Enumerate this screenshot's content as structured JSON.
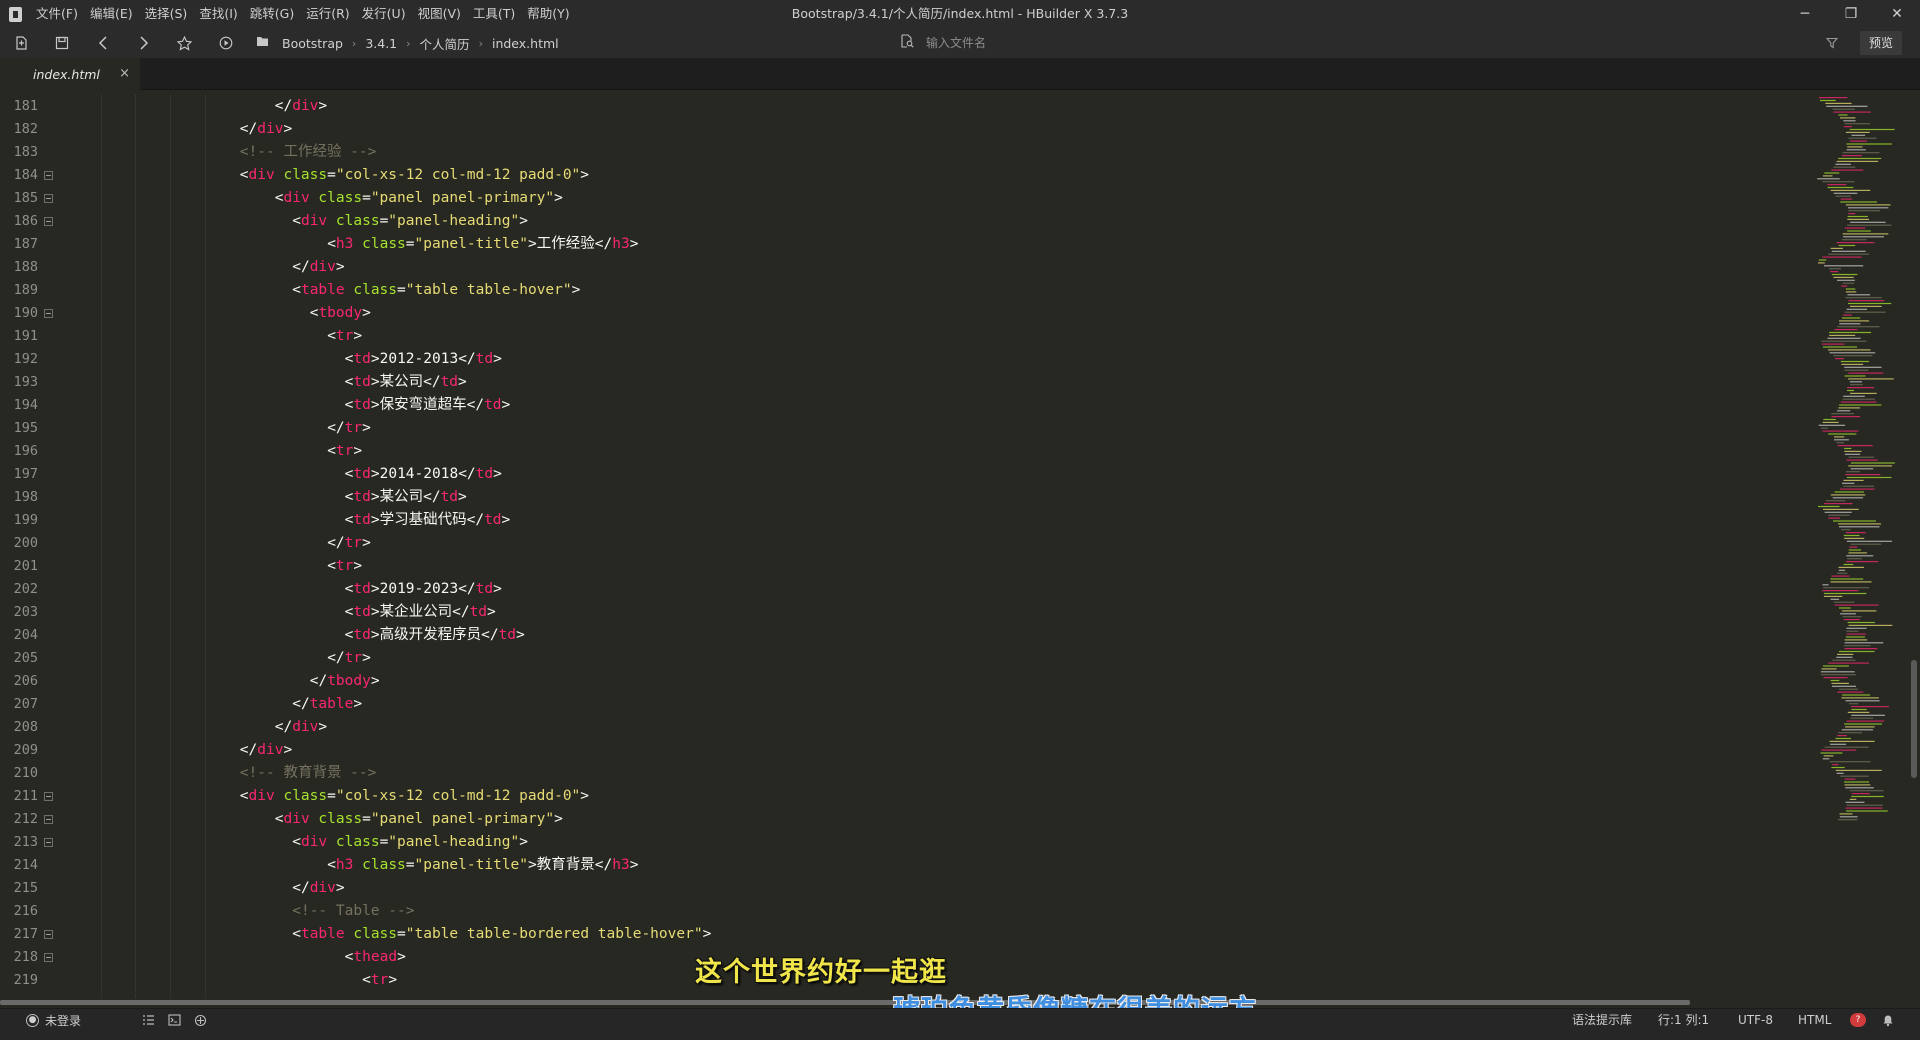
{
  "window": {
    "title": "Bootstrap/3.4.1/个人简历/index.html - HBuilder X 3.7.3",
    "controls": {
      "minimize": "─",
      "restore": "❐",
      "close": "✕"
    }
  },
  "menu": [
    "文件(F)",
    "编辑(E)",
    "选择(S)",
    "查找(I)",
    "跳转(G)",
    "运行(R)",
    "发行(U)",
    "视图(V)",
    "工具(T)",
    "帮助(Y)"
  ],
  "toolbar": {
    "breadcrumbs": [
      "Bootstrap",
      "3.4.1",
      "个人简历",
      "index.html"
    ],
    "search_placeholder": "输入文件名",
    "preview_label": "预览"
  },
  "tabs": [
    {
      "label": "index.html",
      "close": "×"
    }
  ],
  "editor": {
    "lines": [
      {
        "num": "181",
        "fold": false,
        "indent": 24,
        "tokens": [
          [
            "p",
            "</"
          ],
          [
            "t",
            "div"
          ],
          [
            "p",
            ">"
          ]
        ]
      },
      {
        "num": "182",
        "fold": false,
        "indent": 20,
        "tokens": [
          [
            "p",
            "</"
          ],
          [
            "t",
            "div"
          ],
          [
            "p",
            ">"
          ]
        ]
      },
      {
        "num": "183",
        "fold": false,
        "indent": 20,
        "tokens": [
          [
            "c",
            "<!-- 工作经验 -->"
          ]
        ]
      },
      {
        "num": "184",
        "fold": true,
        "indent": 20,
        "tokens": [
          [
            "p",
            "<"
          ],
          [
            "t",
            "div"
          ],
          [
            "p",
            " "
          ],
          [
            "a",
            "class"
          ],
          [
            "p",
            "="
          ],
          [
            "s",
            "\"col-xs-12 col-md-12 padd-0\""
          ],
          [
            "p",
            ">"
          ]
        ]
      },
      {
        "num": "185",
        "fold": true,
        "indent": 24,
        "tokens": [
          [
            "p",
            "<"
          ],
          [
            "t",
            "div"
          ],
          [
            "p",
            " "
          ],
          [
            "a",
            "class"
          ],
          [
            "p",
            "="
          ],
          [
            "s",
            "\"panel panel-primary\""
          ],
          [
            "p",
            ">"
          ]
        ]
      },
      {
        "num": "186",
        "fold": true,
        "indent": 26,
        "tokens": [
          [
            "p",
            "<"
          ],
          [
            "t",
            "div"
          ],
          [
            "p",
            " "
          ],
          [
            "a",
            "class"
          ],
          [
            "p",
            "="
          ],
          [
            "s",
            "\"panel-heading\""
          ],
          [
            "p",
            ">"
          ]
        ]
      },
      {
        "num": "187",
        "fold": false,
        "indent": 30,
        "tokens": [
          [
            "p",
            "<"
          ],
          [
            "t",
            "h3"
          ],
          [
            "p",
            " "
          ],
          [
            "a",
            "class"
          ],
          [
            "p",
            "="
          ],
          [
            "s",
            "\"panel-title\""
          ],
          [
            "p",
            ">"
          ],
          [
            "x",
            "工作经验"
          ],
          [
            "p",
            "</"
          ],
          [
            "t",
            "h3"
          ],
          [
            "p",
            ">"
          ]
        ]
      },
      {
        "num": "188",
        "fold": false,
        "indent": 26,
        "tokens": [
          [
            "p",
            "</"
          ],
          [
            "t",
            "div"
          ],
          [
            "p",
            ">"
          ]
        ]
      },
      {
        "num": "189",
        "fold": false,
        "indent": 26,
        "tokens": [
          [
            "p",
            "<"
          ],
          [
            "t",
            "table"
          ],
          [
            "p",
            " "
          ],
          [
            "a",
            "class"
          ],
          [
            "p",
            "="
          ],
          [
            "s",
            "\"table table-hover\""
          ],
          [
            "p",
            ">"
          ]
        ]
      },
      {
        "num": "190",
        "fold": true,
        "indent": 28,
        "tokens": [
          [
            "p",
            "<"
          ],
          [
            "t",
            "tbody"
          ],
          [
            "p",
            ">"
          ]
        ]
      },
      {
        "num": "191",
        "fold": false,
        "indent": 30,
        "tokens": [
          [
            "p",
            "<"
          ],
          [
            "t",
            "tr"
          ],
          [
            "p",
            ">"
          ]
        ]
      },
      {
        "num": "192",
        "fold": false,
        "indent": 32,
        "tokens": [
          [
            "p",
            "<"
          ],
          [
            "t",
            "td"
          ],
          [
            "p",
            ">"
          ],
          [
            "x",
            "2012-2013"
          ],
          [
            "p",
            "</"
          ],
          [
            "t",
            "td"
          ],
          [
            "p",
            ">"
          ]
        ]
      },
      {
        "num": "193",
        "fold": false,
        "indent": 32,
        "tokens": [
          [
            "p",
            "<"
          ],
          [
            "t",
            "td"
          ],
          [
            "p",
            ">"
          ],
          [
            "x",
            "某公司"
          ],
          [
            "p",
            "</"
          ],
          [
            "t",
            "td"
          ],
          [
            "p",
            ">"
          ]
        ]
      },
      {
        "num": "194",
        "fold": false,
        "indent": 32,
        "tokens": [
          [
            "p",
            "<"
          ],
          [
            "t",
            "td"
          ],
          [
            "p",
            ">"
          ],
          [
            "x",
            "保安弯道超车"
          ],
          [
            "p",
            "</"
          ],
          [
            "t",
            "td"
          ],
          [
            "p",
            ">"
          ]
        ]
      },
      {
        "num": "195",
        "fold": false,
        "indent": 30,
        "tokens": [
          [
            "p",
            "</"
          ],
          [
            "t",
            "tr"
          ],
          [
            "p",
            ">"
          ]
        ]
      },
      {
        "num": "196",
        "fold": false,
        "indent": 30,
        "tokens": [
          [
            "p",
            "<"
          ],
          [
            "t",
            "tr"
          ],
          [
            "p",
            ">"
          ]
        ]
      },
      {
        "num": "197",
        "fold": false,
        "indent": 32,
        "tokens": [
          [
            "p",
            "<"
          ],
          [
            "t",
            "td"
          ],
          [
            "p",
            ">"
          ],
          [
            "x",
            "2014-2018"
          ],
          [
            "p",
            "</"
          ],
          [
            "t",
            "td"
          ],
          [
            "p",
            ">"
          ]
        ]
      },
      {
        "num": "198",
        "fold": false,
        "indent": 32,
        "tokens": [
          [
            "p",
            "<"
          ],
          [
            "t",
            "td"
          ],
          [
            "p",
            ">"
          ],
          [
            "x",
            "某公司"
          ],
          [
            "p",
            "</"
          ],
          [
            "t",
            "td"
          ],
          [
            "p",
            ">"
          ]
        ]
      },
      {
        "num": "199",
        "fold": false,
        "indent": 32,
        "tokens": [
          [
            "p",
            "<"
          ],
          [
            "t",
            "td"
          ],
          [
            "p",
            ">"
          ],
          [
            "x",
            "学习基础代码"
          ],
          [
            "p",
            "</"
          ],
          [
            "t",
            "td"
          ],
          [
            "p",
            ">"
          ]
        ]
      },
      {
        "num": "200",
        "fold": false,
        "indent": 30,
        "tokens": [
          [
            "p",
            "</"
          ],
          [
            "t",
            "tr"
          ],
          [
            "p",
            ">"
          ]
        ]
      },
      {
        "num": "201",
        "fold": false,
        "indent": 30,
        "tokens": [
          [
            "p",
            "<"
          ],
          [
            "t",
            "tr"
          ],
          [
            "p",
            ">"
          ]
        ]
      },
      {
        "num": "202",
        "fold": false,
        "indent": 32,
        "tokens": [
          [
            "p",
            "<"
          ],
          [
            "t",
            "td"
          ],
          [
            "p",
            ">"
          ],
          [
            "x",
            "2019-2023"
          ],
          [
            "p",
            "</"
          ],
          [
            "t",
            "td"
          ],
          [
            "p",
            ">"
          ]
        ]
      },
      {
        "num": "203",
        "fold": false,
        "indent": 32,
        "tokens": [
          [
            "p",
            "<"
          ],
          [
            "t",
            "td"
          ],
          [
            "p",
            ">"
          ],
          [
            "x",
            "某企业公司"
          ],
          [
            "p",
            "</"
          ],
          [
            "t",
            "td"
          ],
          [
            "p",
            ">"
          ]
        ]
      },
      {
        "num": "204",
        "fold": false,
        "indent": 32,
        "tokens": [
          [
            "p",
            "<"
          ],
          [
            "t",
            "td"
          ],
          [
            "p",
            ">"
          ],
          [
            "x",
            "高级开发程序员"
          ],
          [
            "p",
            "</"
          ],
          [
            "t",
            "td"
          ],
          [
            "p",
            ">"
          ]
        ]
      },
      {
        "num": "205",
        "fold": false,
        "indent": 30,
        "tokens": [
          [
            "p",
            "</"
          ],
          [
            "t",
            "tr"
          ],
          [
            "p",
            ">"
          ]
        ]
      },
      {
        "num": "206",
        "fold": false,
        "indent": 28,
        "tokens": [
          [
            "p",
            "</"
          ],
          [
            "t",
            "tbody"
          ],
          [
            "p",
            ">"
          ]
        ]
      },
      {
        "num": "207",
        "fold": false,
        "indent": 26,
        "tokens": [
          [
            "p",
            "</"
          ],
          [
            "t",
            "table"
          ],
          [
            "p",
            ">"
          ]
        ]
      },
      {
        "num": "208",
        "fold": false,
        "indent": 24,
        "tokens": [
          [
            "p",
            "</"
          ],
          [
            "t",
            "div"
          ],
          [
            "p",
            ">"
          ]
        ]
      },
      {
        "num": "209",
        "fold": false,
        "indent": 20,
        "tokens": [
          [
            "p",
            "</"
          ],
          [
            "t",
            "div"
          ],
          [
            "p",
            ">"
          ]
        ]
      },
      {
        "num": "210",
        "fold": false,
        "indent": 20,
        "tokens": [
          [
            "c",
            "<!-- 教育背景 -->"
          ]
        ]
      },
      {
        "num": "211",
        "fold": true,
        "indent": 20,
        "tokens": [
          [
            "p",
            "<"
          ],
          [
            "t",
            "div"
          ],
          [
            "p",
            " "
          ],
          [
            "a",
            "class"
          ],
          [
            "p",
            "="
          ],
          [
            "s",
            "\"col-xs-12 col-md-12 padd-0\""
          ],
          [
            "p",
            ">"
          ]
        ]
      },
      {
        "num": "212",
        "fold": true,
        "indent": 24,
        "tokens": [
          [
            "p",
            "<"
          ],
          [
            "t",
            "div"
          ],
          [
            "p",
            " "
          ],
          [
            "a",
            "class"
          ],
          [
            "p",
            "="
          ],
          [
            "s",
            "\"panel panel-primary\""
          ],
          [
            "p",
            ">"
          ]
        ]
      },
      {
        "num": "213",
        "fold": true,
        "indent": 26,
        "tokens": [
          [
            "p",
            "<"
          ],
          [
            "t",
            "div"
          ],
          [
            "p",
            " "
          ],
          [
            "a",
            "class"
          ],
          [
            "p",
            "="
          ],
          [
            "s",
            "\"panel-heading\""
          ],
          [
            "p",
            ">"
          ]
        ]
      },
      {
        "num": "214",
        "fold": false,
        "indent": 30,
        "tokens": [
          [
            "p",
            "<"
          ],
          [
            "t",
            "h3"
          ],
          [
            "p",
            " "
          ],
          [
            "a",
            "class"
          ],
          [
            "p",
            "="
          ],
          [
            "s",
            "\"panel-title\""
          ],
          [
            "p",
            ">"
          ],
          [
            "x",
            "教育背景"
          ],
          [
            "p",
            "</"
          ],
          [
            "t",
            "h3"
          ],
          [
            "p",
            ">"
          ]
        ]
      },
      {
        "num": "215",
        "fold": false,
        "indent": 26,
        "tokens": [
          [
            "p",
            "</"
          ],
          [
            "t",
            "div"
          ],
          [
            "p",
            ">"
          ]
        ]
      },
      {
        "num": "216",
        "fold": false,
        "indent": 26,
        "tokens": [
          [
            "c",
            "<!-- Table -->"
          ]
        ]
      },
      {
        "num": "217",
        "fold": true,
        "indent": 26,
        "tokens": [
          [
            "p",
            "<"
          ],
          [
            "t",
            "table"
          ],
          [
            "p",
            " "
          ],
          [
            "a",
            "class"
          ],
          [
            "p",
            "="
          ],
          [
            "s",
            "\"table table-bordered table-hover\""
          ],
          [
            "p",
            ">"
          ]
        ]
      },
      {
        "num": "218",
        "fold": true,
        "indent": 32,
        "tokens": [
          [
            "p",
            "<"
          ],
          [
            "t",
            "thead"
          ],
          [
            "p",
            ">"
          ]
        ]
      },
      {
        "num": "219",
        "fold": false,
        "indent": 34,
        "tokens": [
          [
            "p",
            "<"
          ],
          [
            "t",
            "tr"
          ],
          [
            "p",
            ">"
          ]
        ]
      }
    ]
  },
  "subtitles": {
    "line1": "这个世界约好一起逛",
    "line2": "琥珀色黄昏像糖在很美的远方"
  },
  "statusbar": {
    "login": "未登录",
    "syntax_lib": "语法提示库",
    "cursor": "行:1  列:1",
    "encoding": "UTF-8",
    "language": "HTML"
  },
  "colors": {
    "editor_bg": "#272822",
    "tag": "#f92672",
    "attribute": "#a6e22e",
    "string": "#e6db74",
    "comment": "#75715e"
  }
}
